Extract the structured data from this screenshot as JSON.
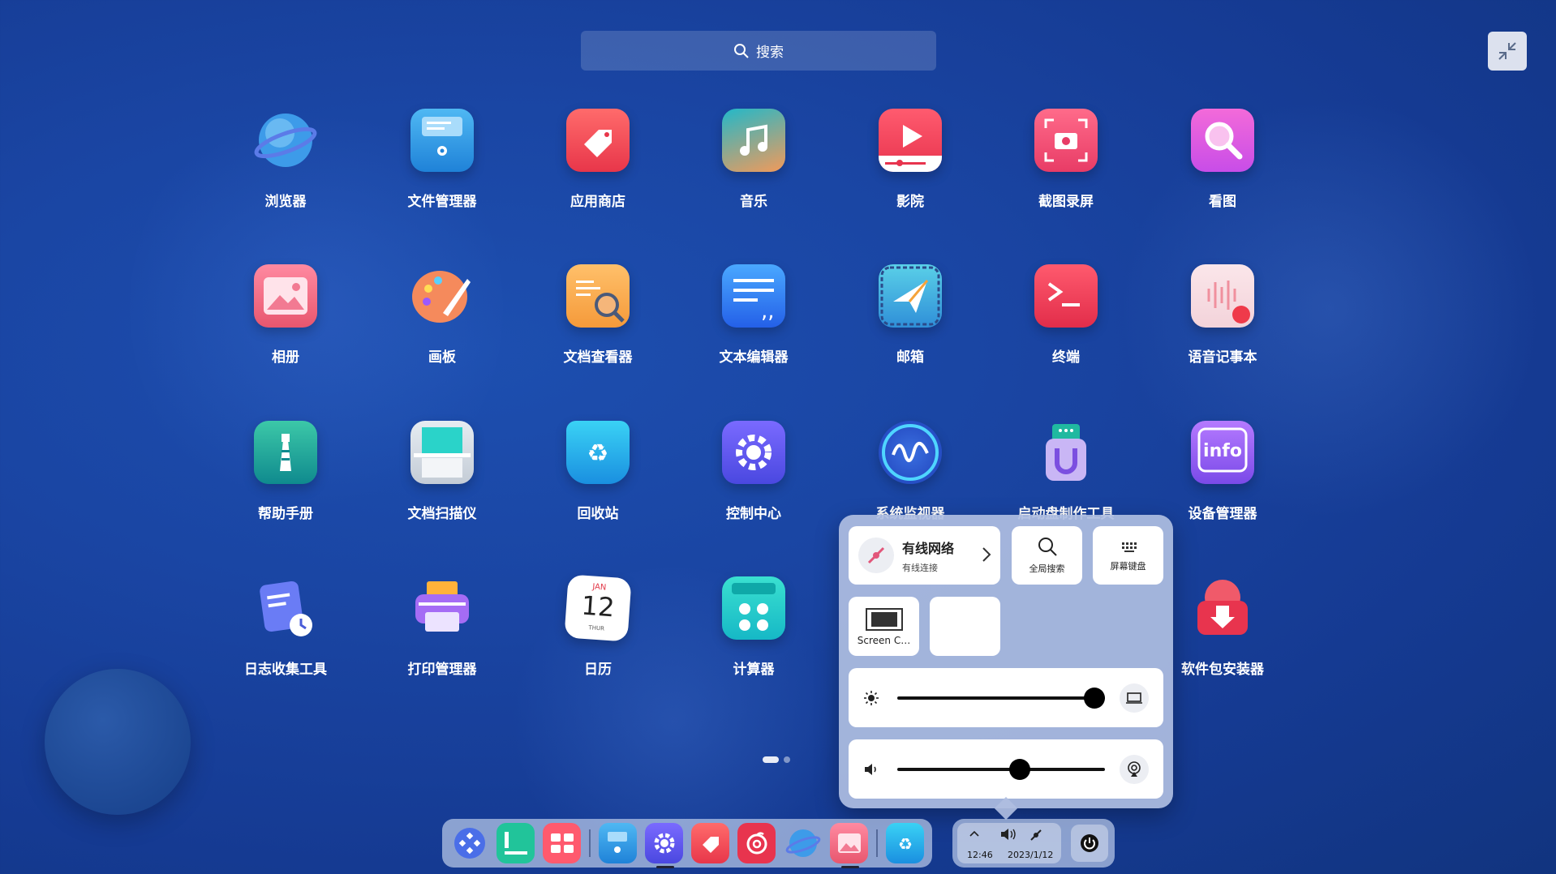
{
  "search": {
    "placeholder": "搜索"
  },
  "apps": [
    {
      "label": "浏览器",
      "icon": "browser-icon"
    },
    {
      "label": "文件管理器",
      "icon": "file-manager-icon"
    },
    {
      "label": "应用商店",
      "icon": "app-store-icon"
    },
    {
      "label": "音乐",
      "icon": "music-icon"
    },
    {
      "label": "影院",
      "icon": "video-icon"
    },
    {
      "label": "截图录屏",
      "icon": "screenshot-icon"
    },
    {
      "label": "看图",
      "icon": "image-viewer-icon"
    },
    {
      "label": "相册",
      "icon": "album-icon"
    },
    {
      "label": "画板",
      "icon": "draw-icon"
    },
    {
      "label": "文档查看器",
      "icon": "document-viewer-icon"
    },
    {
      "label": "文本编辑器",
      "icon": "text-editor-icon"
    },
    {
      "label": "邮箱",
      "icon": "mail-icon"
    },
    {
      "label": "终端",
      "icon": "terminal-icon"
    },
    {
      "label": "语音记事本",
      "icon": "voice-note-icon"
    },
    {
      "label": "帮助手册",
      "icon": "manual-icon"
    },
    {
      "label": "文档扫描仪",
      "icon": "scanner-icon"
    },
    {
      "label": "回收站",
      "icon": "trash-icon"
    },
    {
      "label": "控制中心",
      "icon": "control-center-icon"
    },
    {
      "label": "系统监视器",
      "icon": "system-monitor-icon"
    },
    {
      "label": "启动盘制作工具",
      "icon": "boot-maker-icon"
    },
    {
      "label": "设备管理器",
      "icon": "device-manager-icon"
    },
    {
      "label": "日志收集工具",
      "icon": "log-collector-icon"
    },
    {
      "label": "打印管理器",
      "icon": "print-manager-icon"
    },
    {
      "label": "日历",
      "icon": "calendar-icon"
    },
    {
      "label": "计算器",
      "icon": "calculator-icon"
    },
    {
      "label": "",
      "icon": ""
    },
    {
      "label": "",
      "icon": ""
    },
    {
      "label": "软件包安装器",
      "icon": "package-installer-icon"
    }
  ],
  "calendar_icon": {
    "month": "JAN",
    "day": "12",
    "weekday": "THUR"
  },
  "device_info_text": "info",
  "control_panel": {
    "network_title": "有线网络",
    "network_sub": "有线连接",
    "global_search": "全局搜索",
    "screen_keyboard": "屏幕键盘",
    "screen_capture": "Screen C…",
    "brightness_value": 0.95,
    "volume_value": 0.59
  },
  "tray": {
    "time": "12:46",
    "date": "2023/1/12"
  },
  "pager": {
    "pages": 2,
    "current": 1
  }
}
